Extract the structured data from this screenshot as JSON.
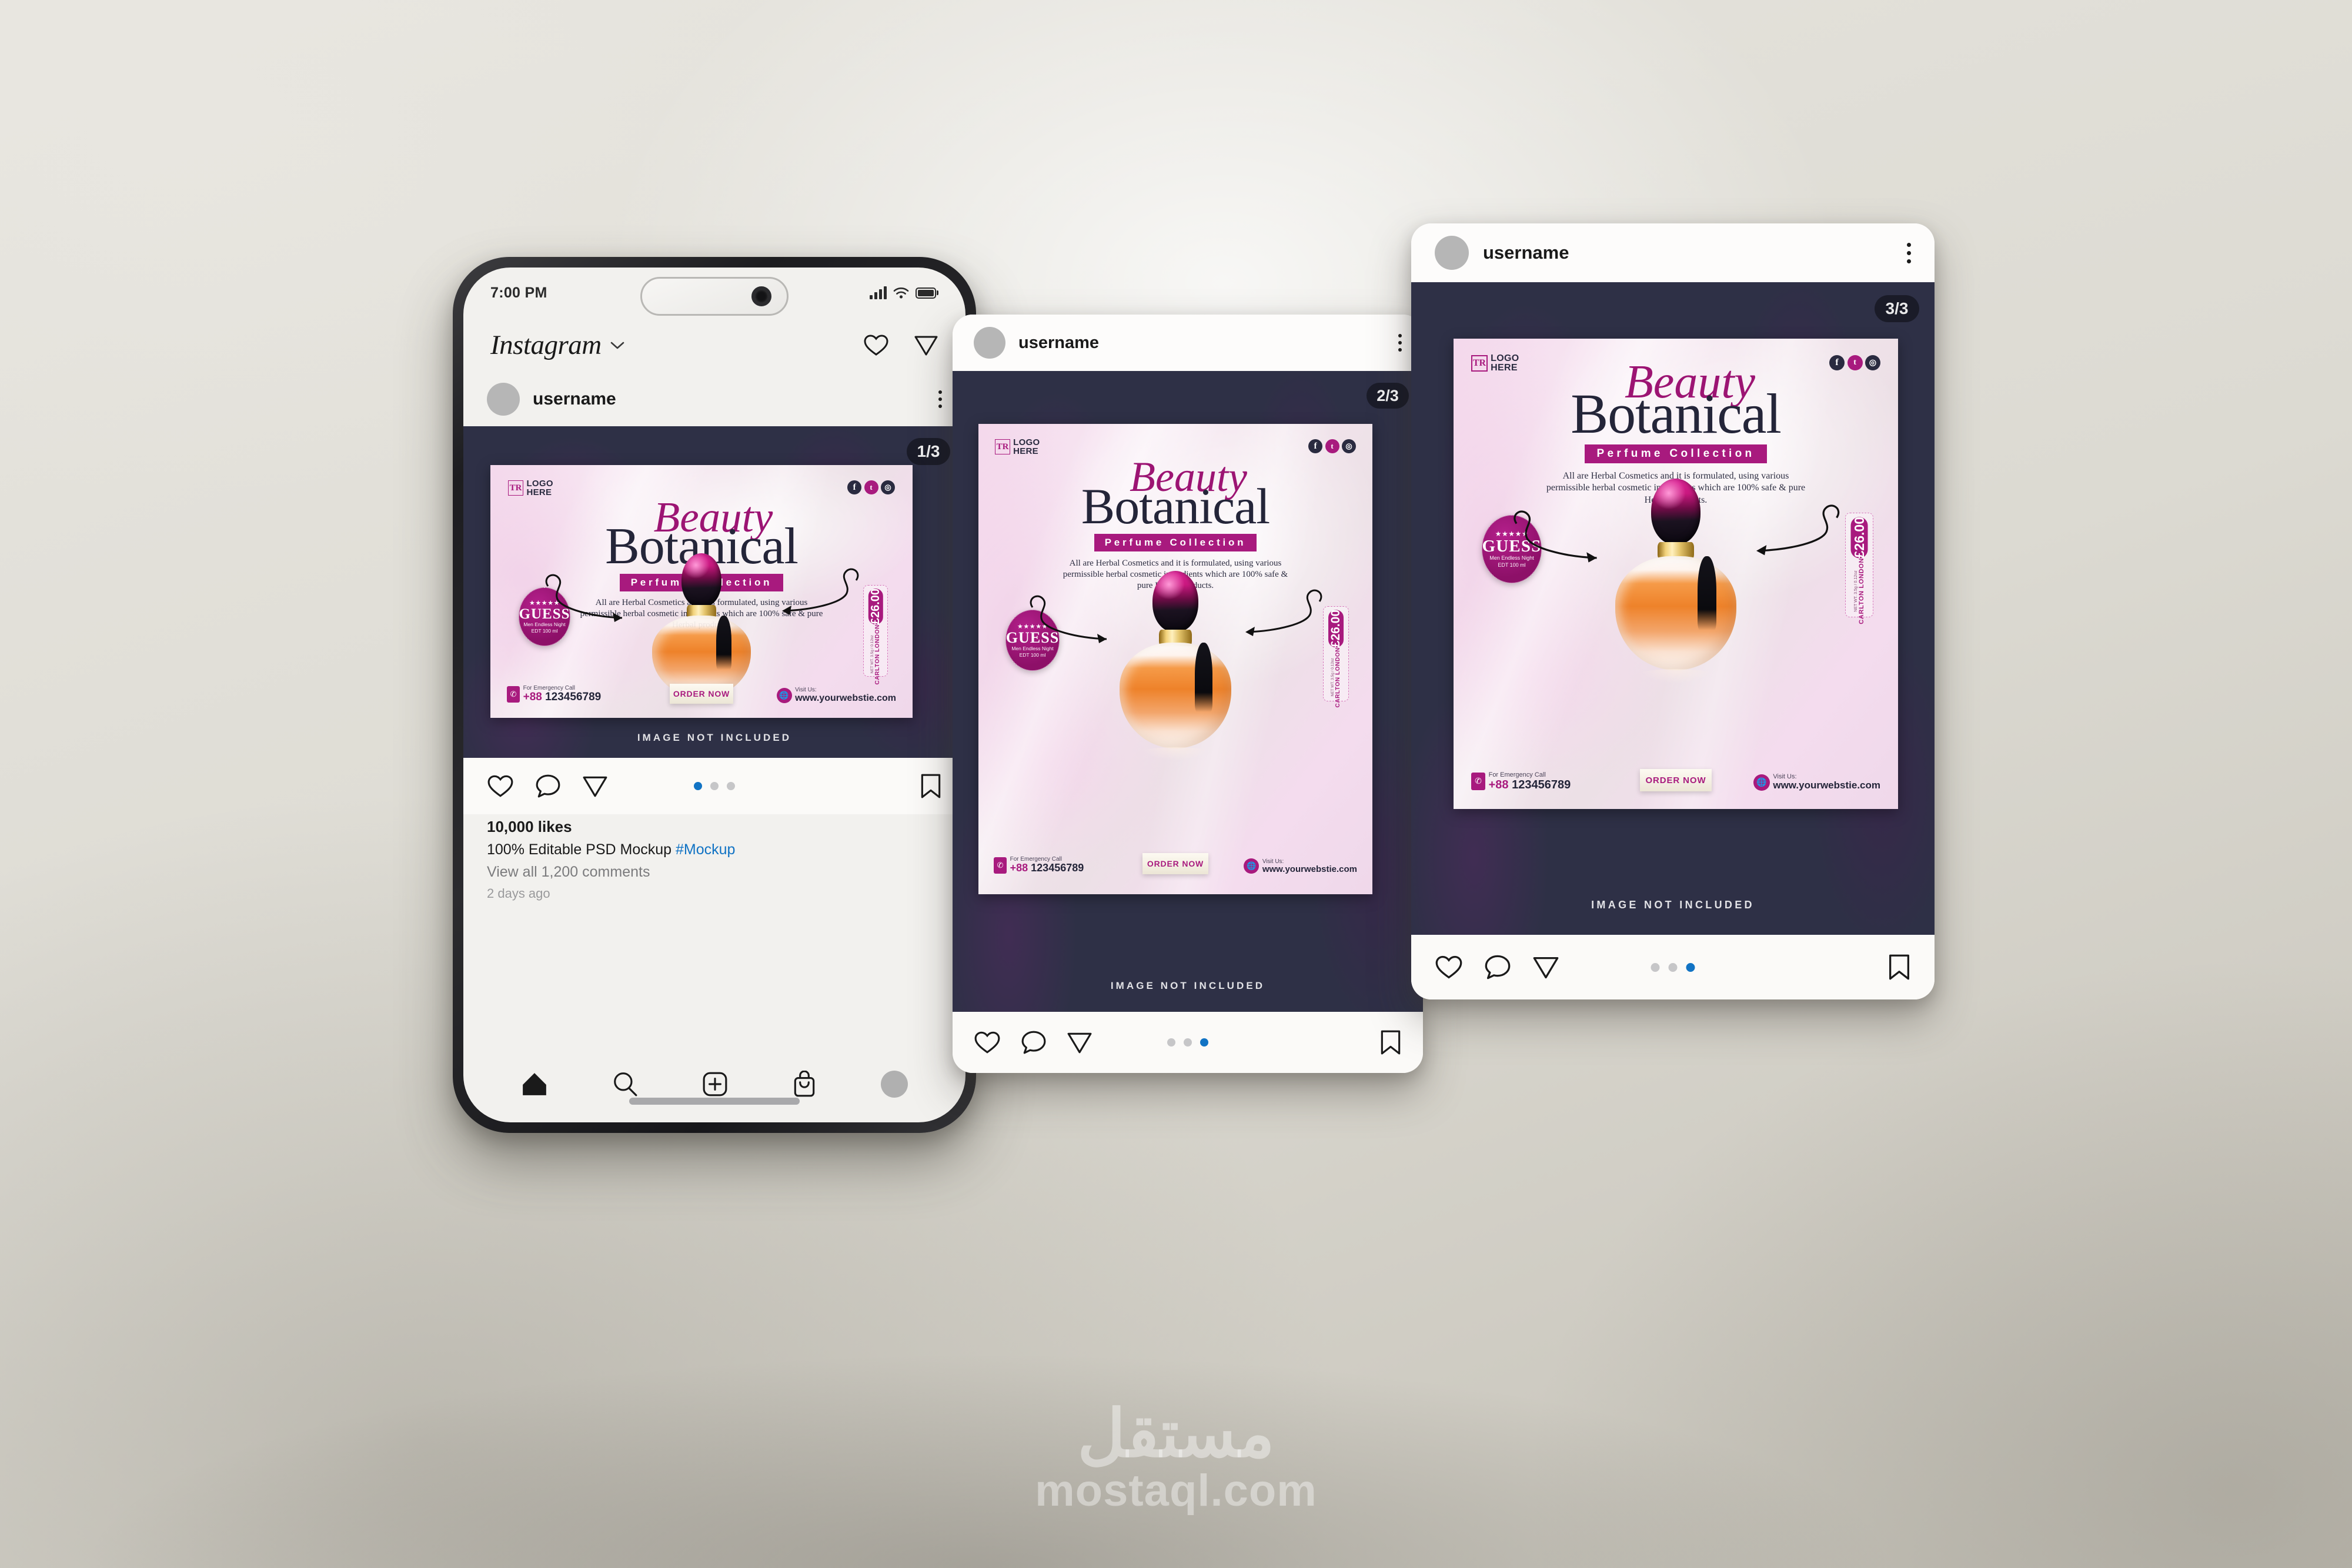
{
  "watermark": {
    "arabic": "مستقل",
    "url": "mostaql.com"
  },
  "phone": {
    "status": {
      "time": "7:00 PM",
      "signal_icon": "signal-bars-icon",
      "wifi_icon": "wifi-icon",
      "battery_icon": "battery-icon"
    },
    "topbar": {
      "logo": "Instagram",
      "chevron_icon": "chevron-down-icon",
      "heart_icon": "heart-icon",
      "send_icon": "send-icon"
    },
    "post": {
      "username": "username",
      "count_badge": "1/3",
      "not_included": "IMAGE NOT INCLUDED",
      "likes": "10,000 likes",
      "caption": "100% Editable PSD Mockup",
      "hashtag": "#Mockup",
      "comments": "View all 1,200 comments",
      "time": "2 days ago",
      "active_dot": 1
    },
    "actions": {
      "like_icon": "heart-icon",
      "comment_icon": "comment-icon",
      "share_icon": "send-icon",
      "save_icon": "bookmark-icon"
    },
    "nav": {
      "home_icon": "home-icon",
      "search_icon": "search-icon",
      "create_icon": "plus-square-icon",
      "shop_icon": "shopping-bag-icon",
      "profile_icon": "avatar-icon"
    }
  },
  "card2": {
    "username": "username",
    "menu_icon": "kebab-menu-icon",
    "count_badge": "2/3",
    "not_included": "IMAGE NOT INCLUDED",
    "active_dot": 3
  },
  "card3": {
    "username": "username",
    "menu_icon": "kebab-menu-icon",
    "count_badge": "3/3",
    "not_included": "IMAGE NOT INCLUDED",
    "active_dot": 3
  },
  "poster": {
    "logo_mark": "TR",
    "logo_line1": "LOGO",
    "logo_line2": "HERE",
    "socials": [
      "facebook-icon",
      "twitter-icon",
      "instagram-icon"
    ],
    "title_script": "Beauty",
    "title_serif": "Botanical",
    "ribbon": "Perfume Collection",
    "description": "All are Herbal Cosmetics and it is formulated, using various permissible herbal cosmetic ingredients which are 100% safe & pure Herbal products.",
    "badge": {
      "stars": "★★★★★",
      "brand": "GUESS",
      "line1": "Men Endless Night",
      "line2": "EDT 100 ml"
    },
    "price": {
      "amount": "£26.00",
      "brand": "CARLTON LONDON",
      "net": "NET WT. 3.5g / 0.12oz"
    },
    "order_button": "ORDER NOW",
    "contact": {
      "phone_icon": "phone-icon",
      "phone_label": "For Emergency Call",
      "phone_prefix": "+88",
      "phone_number": "123456789",
      "web_icon": "globe-icon",
      "web_label": "Visit Us:",
      "web_value": "www.yourwebstie.com"
    }
  },
  "colors": {
    "magenta": "#a81a7e",
    "navy": "#242539",
    "media_bg": "#2e3046",
    "active_dot": "#1173c4"
  }
}
